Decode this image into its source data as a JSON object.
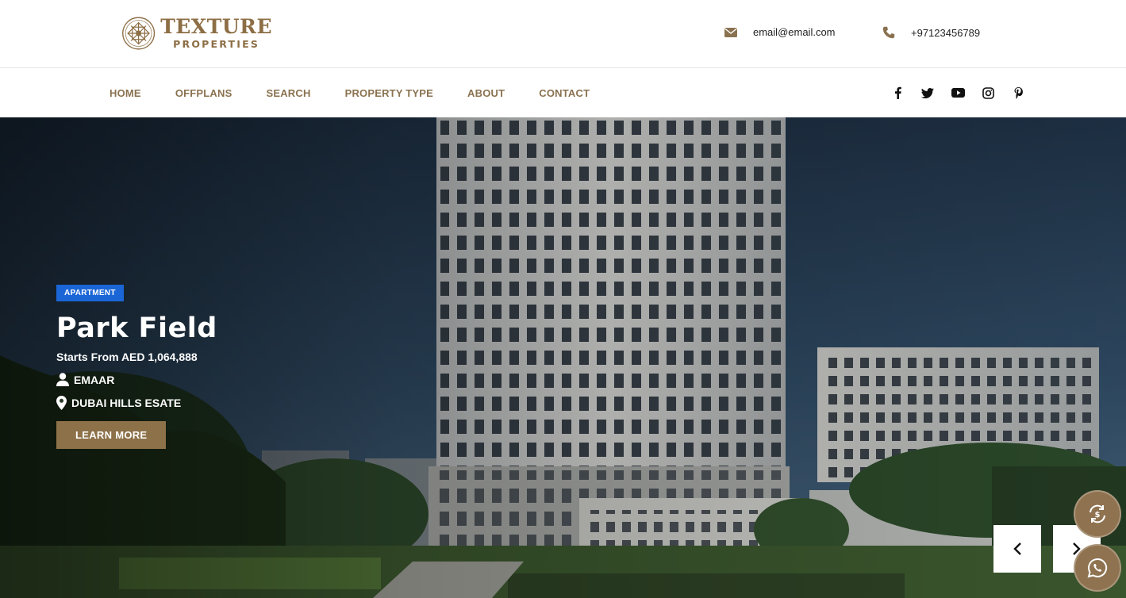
{
  "brand": {
    "title": "TEXTURE",
    "subtitle": "PROPERTIES",
    "color": "#8d6e45"
  },
  "contact": {
    "email": "email@email.com",
    "phone": "+97123456789"
  },
  "nav": {
    "items": [
      "HOME",
      "OFFPLANS",
      "SEARCH",
      "PROPERTY TYPE",
      "ABOUT",
      "CONTACT"
    ]
  },
  "social": [
    "facebook-icon",
    "twitter-icon",
    "youtube-icon",
    "instagram-icon",
    "pinterest-icon"
  ],
  "hero": {
    "badge": "APARTMENT",
    "title": "Park Field",
    "price": "Starts From AED 1,064,888",
    "developer": "EMAAR",
    "location": "DUBAI HILLS ESATE",
    "cta": "LEARN MORE",
    "badge_color": "#1a66d6",
    "cta_color": "#8d7149"
  }
}
